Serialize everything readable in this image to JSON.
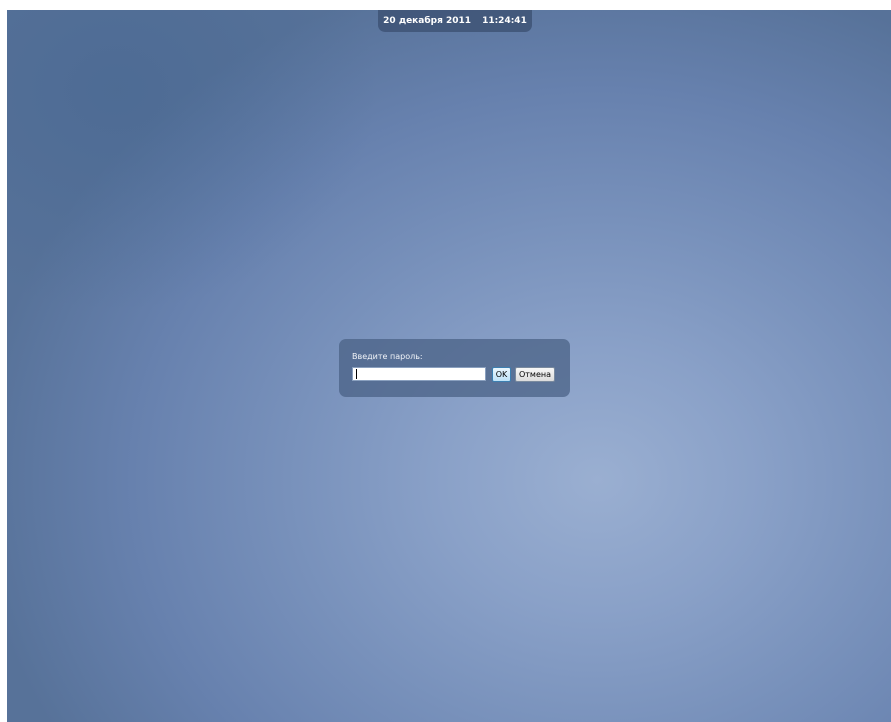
{
  "clock": {
    "date": "20 декабря 2011",
    "time": "11:24:41"
  },
  "password_dialog": {
    "prompt": "Введите пароль:",
    "password_value": "",
    "ok_label": "OK",
    "cancel_label": "Отмена"
  }
}
